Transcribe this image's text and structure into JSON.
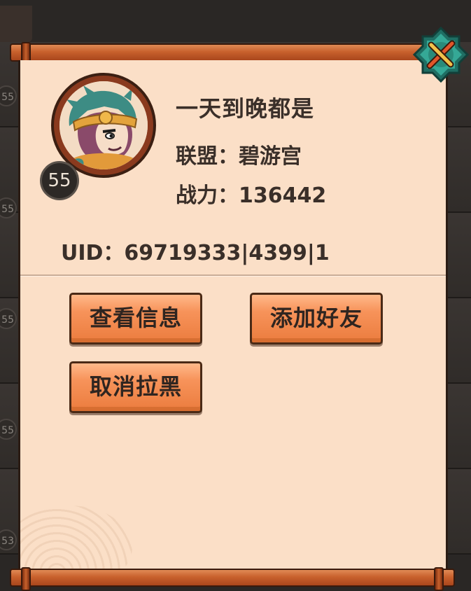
{
  "background": {
    "list_level_badges": [
      "55",
      "55",
      "55",
      "55",
      "55",
      "53"
    ]
  },
  "player": {
    "name": "一天到晚都是",
    "alliance_line": "联盟：碧游宫",
    "power_line": "战力：136442",
    "uid_line": "UID：69719333|4399|1",
    "level": "55"
  },
  "buttons": {
    "view_info": "查看信息",
    "add_friend": "添加好友",
    "unblock": "取消拉黑"
  },
  "icons": {
    "close": "close-icon",
    "avatar": "monkey-king-avatar"
  },
  "colors": {
    "panel": "#fbdfc7",
    "button": "#f7935a",
    "rod": "#c8612d",
    "close_gem": "#2f9e8a"
  }
}
